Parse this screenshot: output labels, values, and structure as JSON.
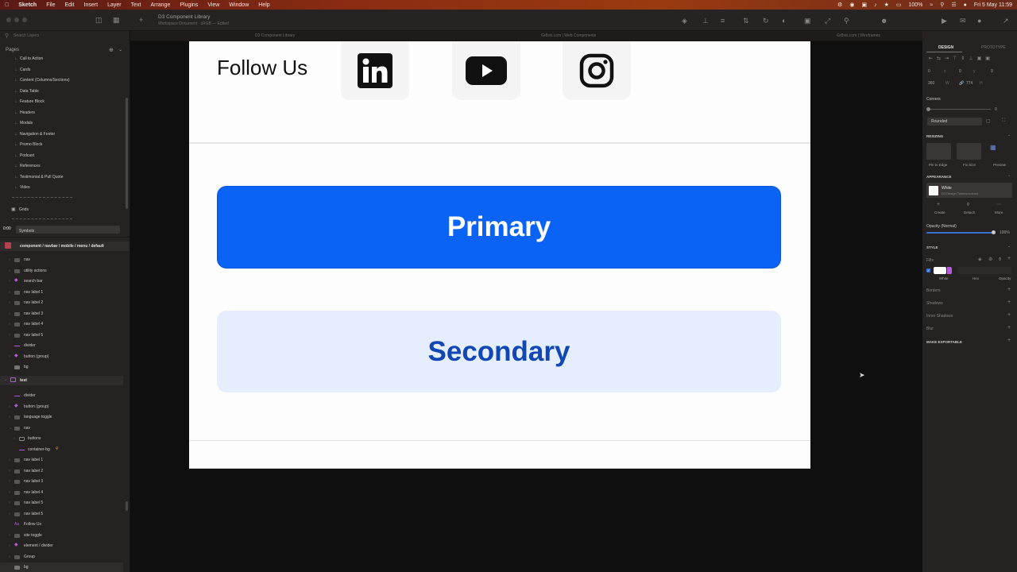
{
  "menubar": {
    "app": "Sketch",
    "items": [
      "File",
      "Edit",
      "Insert",
      "Layer",
      "Text",
      "Arrange",
      "Plugins",
      "View",
      "Window",
      "Help"
    ],
    "zoom": "100%",
    "clock": "Fri 5 May  11:59"
  },
  "titlebar": {
    "title": "D3 Component Library",
    "subtitle": "Workspace Document · sRGB — Edited"
  },
  "tabs": [
    "D3 Component Library",
    "Gr8sis.com | Web Components",
    "Gr8sis.com | Wireframes"
  ],
  "left_panel": {
    "search_placeholder": "Search Layers",
    "pages_label": "Pages",
    "pages": [
      "Call to Action",
      "Cards",
      "Content (Columns/Sections)",
      "Data Table",
      "Feature Block",
      "Headers",
      "Modals",
      "Navigation & Footer",
      "Promo Block",
      "Podcast",
      "References",
      "Testimonial & Pull Quote",
      "Video"
    ],
    "grids": "Grids",
    "timer": "0:00",
    "symbols": "Symbols",
    "selected_symbol": "component / navbar / mobile / menu / default",
    "layers_a": [
      "nav",
      "utility actions",
      "search bar",
      "nav label 1",
      "nav label 2",
      "nav label 3",
      "nav label 4",
      "nav label 5",
      "divider",
      "button (group)",
      "bg"
    ],
    "artboard_name": "test",
    "layers_b": [
      "divider",
      "button (group)",
      "language toggle",
      "nav",
      "buttons",
      "container-bg",
      "nav label 1",
      "nav label 2",
      "nav label 3",
      "nav label 4",
      "nav label 5",
      "nav label 5",
      "Follow Us",
      "site toggle",
      "element / divider",
      "Group",
      "bg"
    ]
  },
  "artboard": {
    "follow_text": "Follow Us",
    "social_icons": [
      "linkedin-icon",
      "youtube-icon",
      "instagram-icon"
    ],
    "primary_label": "Primary",
    "secondary_label": "Secondary"
  },
  "right_panel": {
    "tab_design": "DESIGN",
    "tab_prototype": "PROTOTYPE",
    "x": "0",
    "y": "0",
    "w": "360",
    "h": "774",
    "corners_label": "Corners",
    "corners_value": "0",
    "corner_style": "Rounded",
    "resizing_label": "RESIZING",
    "resize_options": [
      "Pin to Edge",
      "Fix Size",
      "Preview"
    ],
    "appearance_label": "APPEARANCE",
    "appearance_name": "White",
    "appearance_sub": "D3 Design Tokens/colours",
    "appearance_actions": [
      "Create",
      "Detach",
      "More"
    ],
    "opacity_label": "Opacity (Normal)",
    "opacity_value": "100%",
    "style_label": "STYLE",
    "fills_label": "Fills",
    "fill_labels": [
      "White",
      "Hex",
      "Opacity"
    ],
    "sections": [
      "Borders",
      "Shadows",
      "Inner Shadows",
      "Blur"
    ],
    "export_label": "MAKE EXPORTABLE"
  },
  "colors": {
    "primary": "#0a63f5",
    "secondary_bg": "#e5eefc",
    "secondary_text": "#1146b4",
    "symbol_accent": "#b55bd9"
  }
}
